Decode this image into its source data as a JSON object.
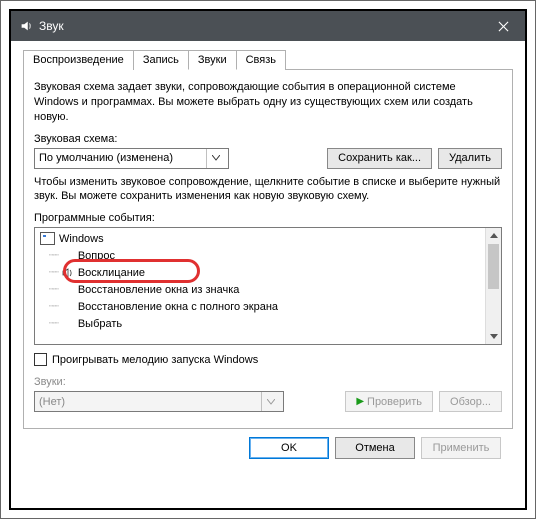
{
  "window": {
    "title": "Звук"
  },
  "tabs": {
    "playback": "Воспроизведение",
    "recording": "Запись",
    "sounds": "Звуки",
    "comm": "Связь"
  },
  "panel": {
    "scheme_desc": "Звуковая схема задает звуки, сопровождающие события в операционной системе Windows и программах. Вы можете выбрать одну из существующих схем или создать новую.",
    "scheme_label": "Звуковая схема:",
    "scheme_value": "По умолчанию (изменена)",
    "save_as": "Сохранить как...",
    "delete": "Удалить",
    "events_desc": "Чтобы изменить звуковое сопровождение, щелкните событие в списке и выберите нужный звук. Вы можете сохранить изменения как новую звуковую схему.",
    "events_label": "Программные события:",
    "tree": {
      "root": "Windows",
      "items": [
        "Вопрос",
        "Восклицание",
        "Восстановление окна из значка",
        "Восстановление окна с полного экрана",
        "Выбрать"
      ]
    },
    "play_startup": "Проигрывать мелодию запуска Windows",
    "sounds_label": "Звуки:",
    "sounds_value": "(Нет)",
    "test": "Проверить",
    "browse": "Обзор..."
  },
  "buttons": {
    "ok": "OK",
    "cancel": "Отмена",
    "apply": "Применить"
  }
}
